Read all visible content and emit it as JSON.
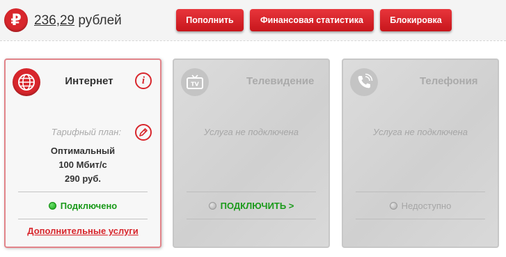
{
  "balance": {
    "currency_symbol": "₽",
    "amount": "236,29",
    "unit": "рублей"
  },
  "toolbar": {
    "topup_label": "Пополнить",
    "stats_label": "Финансовая статистика",
    "block_label": "Блокировка"
  },
  "cards": [
    {
      "title": "Интернет",
      "icon": "globe-icon",
      "plan_label": "Тарифный план:",
      "plan_lines": [
        "Оптимальный",
        "100 Мбит/с",
        "290 руб."
      ],
      "status": "Подключено",
      "status_color": "#1a9a1a",
      "extra_link": "Дополнительные услуги"
    },
    {
      "title": "Телевидение",
      "icon": "tv-icon",
      "message": "Услуга не подключена",
      "status": "ПОДКЛЮЧИТЬ >",
      "status_color": "#1a9a1a"
    },
    {
      "title": "Телефония",
      "icon": "phone-icon",
      "message": "Услуга не подключена",
      "status": "Недоступно",
      "status_color": "#a6a6a6"
    }
  ],
  "colors": {
    "accent": "#d8262c",
    "card_disabled": "#d6d6d6"
  }
}
